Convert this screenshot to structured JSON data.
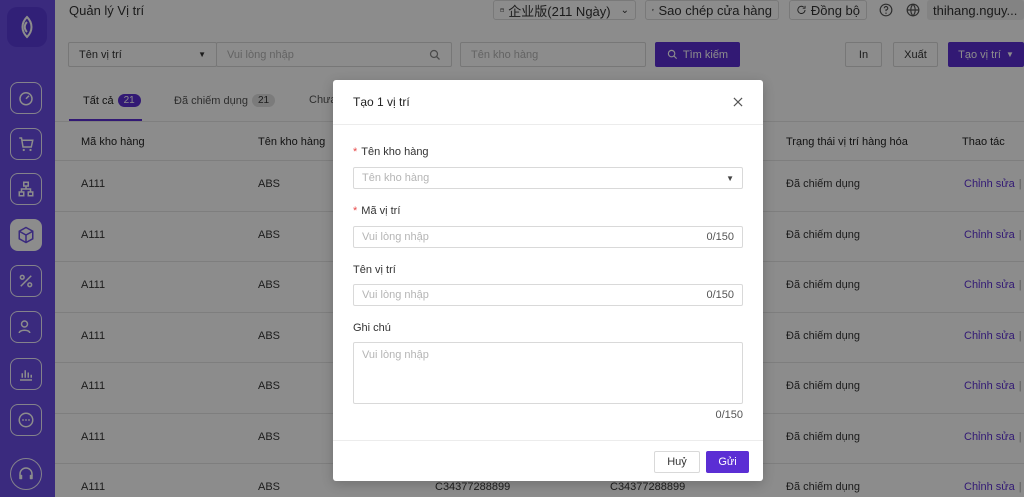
{
  "header": {
    "title": "Quản lý Vị trí",
    "plan_label": "企业版(211 Ngày)",
    "copy_label": "Sao chép cửa hàng",
    "sync_label": "Đồng bộ",
    "user_name": "thihang.nguy..."
  },
  "filter": {
    "field_select": "Tên vị trí",
    "search_placeholder": "Vui lòng nhập",
    "warehouse_placeholder": "Tên kho hàng",
    "search_button": "Tìm kiếm",
    "print_button": "In",
    "export_button": "Xuất",
    "create_button": "Tạo vị trí"
  },
  "tabs": [
    {
      "label": "Tất cả",
      "count": "21"
    },
    {
      "label": "Đã chiếm dụng",
      "count": "21"
    },
    {
      "label": "Chưa"
    }
  ],
  "table": {
    "columns": [
      "Mã kho hàng",
      "Tên kho hàng",
      "Trạng thái vị trí hàng hóa",
      "Thao tác"
    ],
    "rows": [
      {
        "code": "A111",
        "name": "ABS",
        "status": "Đã chiếm dụng",
        "action": "Chỉnh sửa"
      },
      {
        "code": "A111",
        "name": "ABS",
        "status": "Đã chiếm dụng",
        "action": "Chỉnh sửa"
      },
      {
        "code": "A111",
        "name": "ABS",
        "status": "Đã chiếm dụng",
        "action": "Chỉnh sửa"
      },
      {
        "code": "A111",
        "name": "ABS",
        "status": "Đã chiếm dụng",
        "action": "Chỉnh sửa"
      },
      {
        "code": "A111",
        "name": "ABS",
        "status": "Đã chiếm dụng",
        "action": "Chỉnh sửa"
      },
      {
        "code": "A111",
        "name": "ABS",
        "status": "Đã chiếm dụng",
        "action": "Chỉnh sửa"
      },
      {
        "code": "A111",
        "name": "ABS",
        "code2": "C34377288899",
        "code3": "C34377288899",
        "status": "Đã chiếm dụng",
        "action": "Chỉnh sửa"
      }
    ]
  },
  "modal": {
    "title": "Tạo 1 vị trí",
    "warehouse_label": "Tên kho hàng",
    "warehouse_placeholder": "Tên kho hàng",
    "code_label": "Mã vị trí",
    "code_placeholder": "Vui lòng nhập",
    "code_counter": "0/150",
    "name_label": "Tên vị trí",
    "name_placeholder": "Vui lòng nhập",
    "name_counter": "0/150",
    "note_label": "Ghi chú",
    "note_placeholder": "Vui lòng nhập",
    "note_counter": "0/150",
    "cancel_button": "Huỷ",
    "submit_button": "Gửi"
  },
  "colors": {
    "accent": "#5b2ed4",
    "sidebar": "#6b4ee6",
    "required": "#e84a4a"
  },
  "icons": [
    "logo-icon",
    "dashboard-icon",
    "cart-icon",
    "sitemap-icon",
    "box-icon",
    "percent-icon",
    "users-icon",
    "chart-icon",
    "chat-icon",
    "headset-icon",
    "calendar-icon",
    "copy-icon",
    "sync-icon",
    "help-icon",
    "globe-icon",
    "search-icon",
    "close-icon"
  ]
}
